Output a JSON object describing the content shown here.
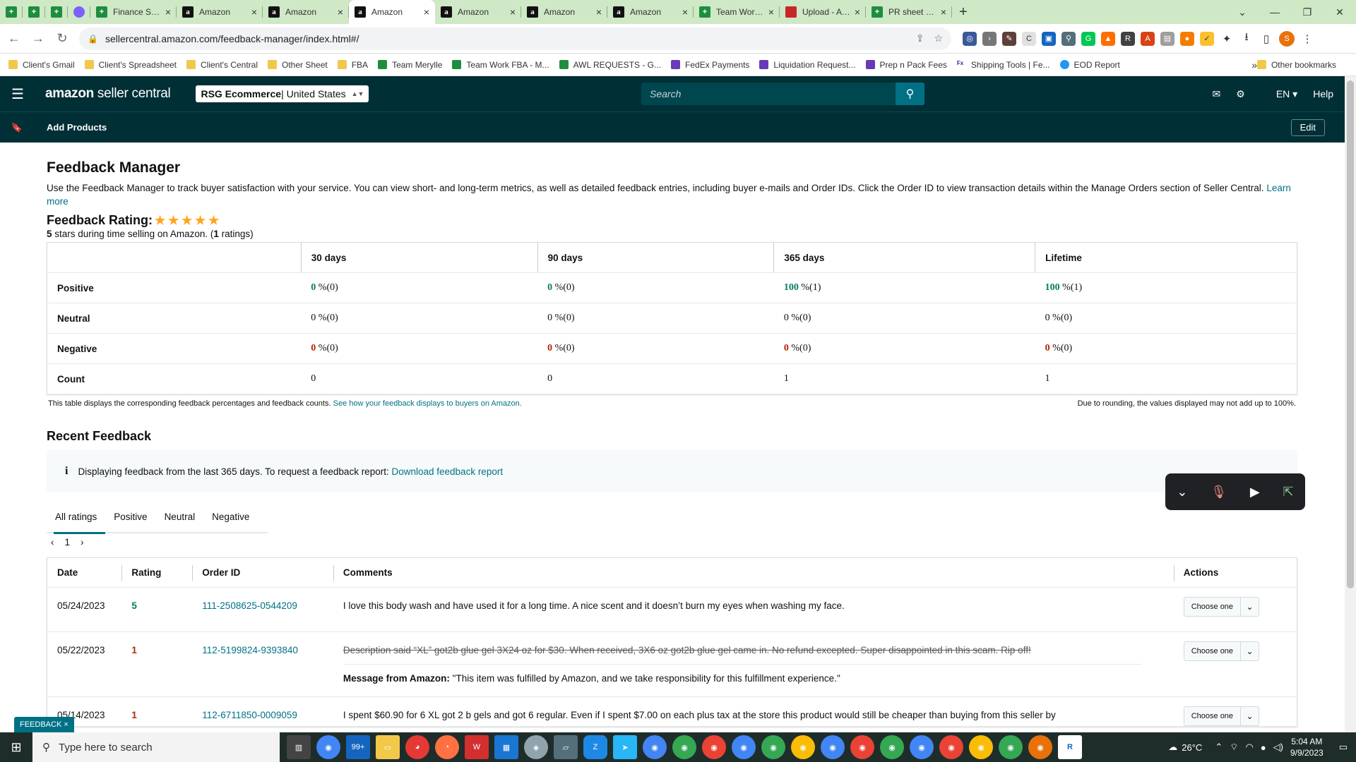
{
  "browser": {
    "tabs": [
      {
        "label": "",
        "icon": "sheet",
        "compact": true
      },
      {
        "label": "",
        "icon": "sheet",
        "compact": true
      },
      {
        "label": "",
        "icon": "sheet",
        "compact": true
      },
      {
        "label": "",
        "icon": "msg",
        "compact": true
      },
      {
        "label": "Finance Sheet -",
        "icon": "sheet"
      },
      {
        "label": "Amazon",
        "icon": "amz"
      },
      {
        "label": "Amazon",
        "icon": "amz"
      },
      {
        "label": "Amazon",
        "icon": "amz",
        "active": true
      },
      {
        "label": "Amazon",
        "icon": "amz"
      },
      {
        "label": "Amazon",
        "icon": "amz"
      },
      {
        "label": "Amazon",
        "icon": "amz"
      },
      {
        "label": "Team Work FBA",
        "icon": "sheet"
      },
      {
        "label": "Upload - AWL L",
        "icon": "pdf"
      },
      {
        "label": "PR sheet Daniel",
        "icon": "sheet"
      }
    ],
    "url": "sellercentral.amazon.com/feedback-manager/index.html#/",
    "bookmarks": [
      {
        "label": "Client's Gmail",
        "icon": "folder"
      },
      {
        "label": "Client's Spreadsheet",
        "icon": "folder"
      },
      {
        "label": "Client's Central",
        "icon": "folder"
      },
      {
        "label": "Other Sheet",
        "icon": "folder"
      },
      {
        "label": "FBA",
        "icon": "folder"
      },
      {
        "label": "Team Merylle",
        "icon": "sheet"
      },
      {
        "label": "Team Work FBA - M...",
        "icon": "sheet"
      },
      {
        "label": "AWL REQUESTS - G...",
        "icon": "sheet"
      },
      {
        "label": "FedEx Payments",
        "icon": "form"
      },
      {
        "label": "Liquidation Request...",
        "icon": "form"
      },
      {
        "label": "Prep n Pack Fees",
        "icon": "form"
      },
      {
        "label": "Shipping Tools | Fe...",
        "icon": "fedex"
      },
      {
        "label": "EOD Report",
        "icon": "eod"
      }
    ],
    "other_bookmarks": "Other bookmarks"
  },
  "seller_nav": {
    "logo_a": "amazon",
    "logo_b": " seller central",
    "store_name": "RSG Ecommerce",
    "store_region": " | United States",
    "search_placeholder": "Search",
    "lang": "EN",
    "help": "Help",
    "add_products": "Add Products",
    "edit": "Edit"
  },
  "page": {
    "title": "Feedback Manager",
    "description": "Use the Feedback Manager to track buyer satisfaction with your service. You can view short- and long-term metrics, as well as detailed feedback entries, including buyer e-mails and Order IDs. Click the Order ID to view transaction details within the Manage Orders section of Seller Central.",
    "learn_more": "Learn more",
    "rating_label": "Feedback Rating:",
    "rating_stars": 5,
    "rating_summary_a": "5",
    "rating_summary_b": " stars during time selling on Amazon. (",
    "rating_summary_c": "1",
    "rating_summary_d": " ratings)"
  },
  "metrics": {
    "columns": [
      "30 days",
      "90 days",
      "365 days",
      "Lifetime"
    ],
    "rows": [
      {
        "label": "Positive",
        "cls": "pos",
        "cells": [
          [
            "0",
            " %(0)"
          ],
          [
            "0",
            " %(0)"
          ],
          [
            "100",
            " %(1)"
          ],
          [
            "100",
            " %(1)"
          ]
        ]
      },
      {
        "label": "Neutral",
        "cls": "",
        "cells": [
          [
            "0",
            " %(0)"
          ],
          [
            "0",
            " %(0)"
          ],
          [
            "0",
            " %(0)"
          ],
          [
            "0",
            " %(0)"
          ]
        ]
      },
      {
        "label": "Negative",
        "cls": "neg",
        "cells": [
          [
            "0",
            " %(0)"
          ],
          [
            "0",
            " %(0)"
          ],
          [
            "0",
            " %(0)"
          ],
          [
            "0",
            " %(0)"
          ]
        ]
      },
      {
        "label": "Count",
        "cls": "",
        "cells": [
          [
            "",
            "0"
          ],
          [
            "",
            "0"
          ],
          [
            "",
            "1"
          ],
          [
            "",
            "1"
          ]
        ]
      }
    ],
    "note_left": "This table displays the corresponding feedback percentages and feedback counts.",
    "note_link": "See how your feedback displays to buyers on Amazon.",
    "note_right": "Due to rounding, the values displayed may not add up to 100%."
  },
  "recent": {
    "title": "Recent Feedback",
    "info_text": "Displaying feedback from the last 365 days. To request a feedback report:",
    "info_link": "Download feedback report",
    "tabs": [
      "All ratings",
      "Positive",
      "Neutral",
      "Negative"
    ],
    "page": "1",
    "columns": [
      "Date",
      "Rating",
      "Order ID",
      "Comments",
      "Actions"
    ],
    "rows": [
      {
        "date": "05/24/2023",
        "rating": "5",
        "order_id": "111-2508625-0544209",
        "comment": "I love this body wash and have used it for a long time. A nice scent and it doesn’t burn my eyes when washing my face.",
        "struck": false,
        "action": "Choose one"
      },
      {
        "date": "05/22/2023",
        "rating": "1",
        "order_id": "112-5199824-9393840",
        "comment": "Description said “XL” got2b glue gel 3X24 oz for $30. When received, 3X6 oz got2b glue gel came in. No refund excepted. Super disappointed in this scam. Rip off!",
        "struck": true,
        "amazon_label": "Message from Amazon:",
        "amazon_msg": " \"This item was fulfilled by Amazon, and we take responsibility for this fulfillment experience.\"",
        "action": "Choose one"
      },
      {
        "date": "05/14/2023",
        "rating": "1",
        "order_id": "112-6711850-0009059",
        "comment": "I spent $60.90 for 6 XL got 2 b gels and got 6 regular. Even if I spent $7.00 on each plus tax at the store this product would still be cheaper than buying from this seller by",
        "struck": false,
        "action": "Choose one"
      }
    ]
  },
  "feedback_tab": "FEEDBACK ×",
  "taskbar": {
    "search_placeholder": "Type here to search",
    "weather": "26°C",
    "time": "5:04 AM",
    "date": "9/9/2023"
  }
}
